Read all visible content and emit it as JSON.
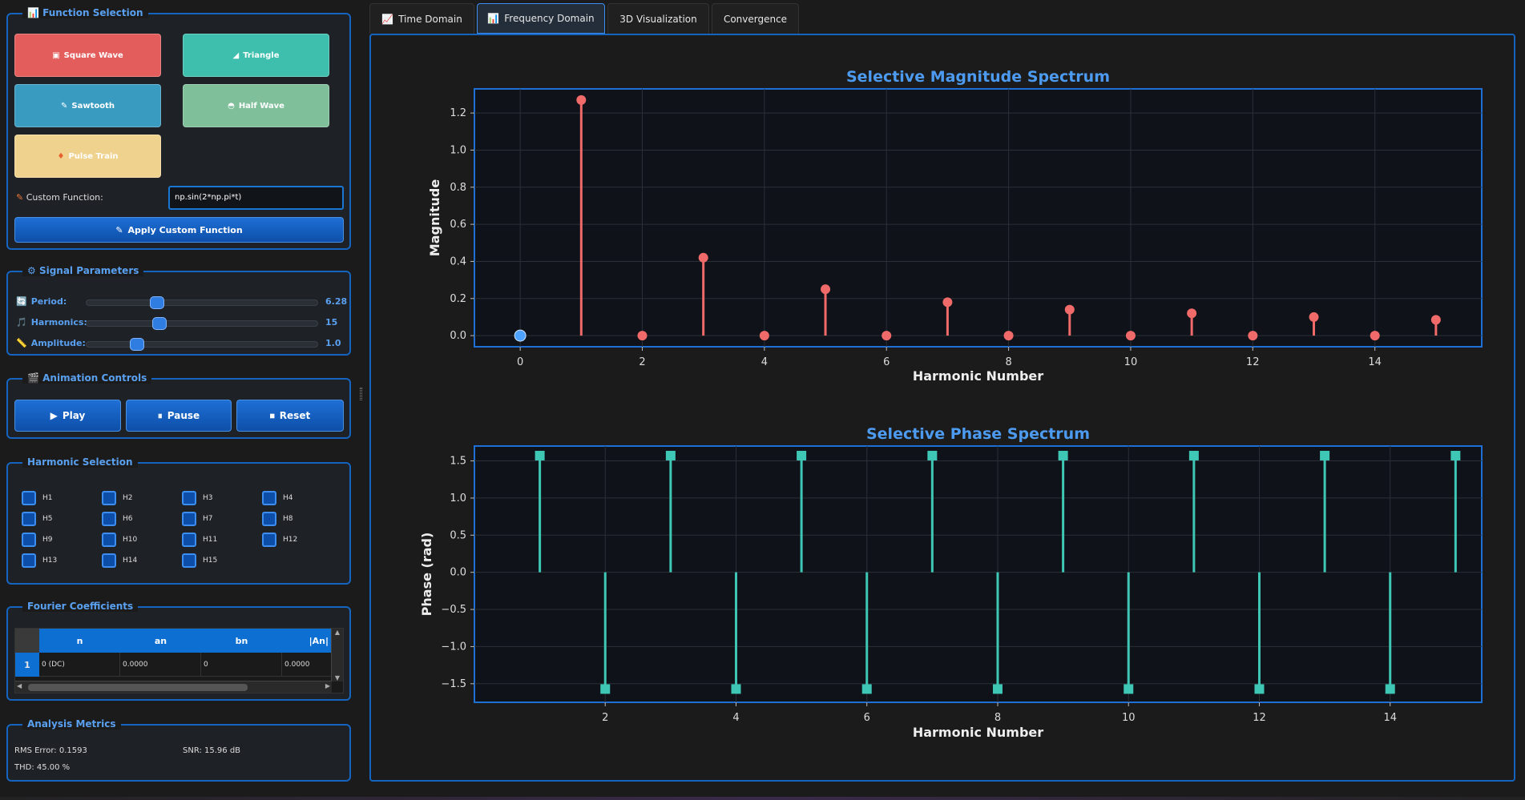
{
  "function_selection": {
    "title": "Function Selection",
    "buttons": [
      {
        "label": "Square Wave",
        "icon": "▣",
        "color": "#e35d5d"
      },
      {
        "label": "Triangle",
        "icon": "◢",
        "color": "#3ebfae"
      },
      {
        "label": "Sawtooth",
        "icon": "✎",
        "color": "#3a9bc0"
      },
      {
        "label": "Half Wave",
        "icon": "◓",
        "color": "#7fbf9a"
      },
      {
        "label": "Pulse Train",
        "icon": "♦",
        "color": "#f0d28f"
      }
    ],
    "custom_label": "Custom Function:",
    "custom_value": "np.sin(2*np.pi*t)",
    "apply_label": "Apply Custom Function"
  },
  "signal_parameters": {
    "title": "Signal Parameters",
    "params": [
      {
        "label": "Period:",
        "value": "6.28",
        "fraction": 0.29
      },
      {
        "label": "Harmonics:",
        "value": "15",
        "fraction": 0.3
      },
      {
        "label": "Amplitude:",
        "value": "1.0",
        "fraction": 0.2
      }
    ]
  },
  "animation_controls": {
    "title": "Animation Controls",
    "buttons": [
      "Play",
      "Pause",
      "Reset"
    ]
  },
  "harmonic_selection": {
    "title": "Harmonic Selection",
    "items": [
      "H1",
      "H2",
      "H3",
      "H4",
      "H5",
      "H6",
      "H7",
      "H8",
      "H9",
      "H10",
      "H11",
      "H12",
      "H13",
      "H14",
      "H15"
    ]
  },
  "fourier_coefficients": {
    "title": "Fourier Coefficients",
    "columns": [
      "n",
      "an",
      "bn",
      "|An|"
    ],
    "rows": [
      {
        "index": "1",
        "cells": [
          "0 (DC)",
          "0.0000",
          "0",
          "0.0000"
        ]
      }
    ]
  },
  "analysis_metrics": {
    "title": "Analysis Metrics",
    "rms": "RMS Error: 0.1593",
    "snr": "SNR: 15.96 dB",
    "thd": "THD: 45.00 %"
  },
  "tabs": [
    {
      "label": "Time Domain",
      "icon": "📈",
      "active": false
    },
    {
      "label": "Frequency Domain",
      "icon": "📊",
      "active": true
    },
    {
      "label": "3D Visualization",
      "icon": "",
      "active": false
    },
    {
      "label": "Convergence",
      "icon": "",
      "active": false
    }
  ],
  "chart_data": [
    {
      "type": "stem",
      "title": "Selective Magnitude Spectrum",
      "xlabel": "Harmonic Number",
      "ylabel": "Magnitude",
      "xlim": [
        -0.75,
        15.75
      ],
      "ylim": [
        -0.06,
        1.33
      ],
      "xticks": [
        0,
        2,
        4,
        6,
        8,
        10,
        12,
        14
      ],
      "yticks": [
        0.0,
        0.2,
        0.4,
        0.6,
        0.8,
        1.0,
        1.2
      ],
      "x": [
        0,
        1,
        2,
        3,
        4,
        5,
        6,
        7,
        8,
        9,
        10,
        11,
        12,
        13,
        14,
        15
      ],
      "values": [
        0,
        1.27,
        0,
        0.42,
        0,
        0.25,
        0,
        0.18,
        0,
        0.14,
        0,
        0.12,
        0,
        0.1,
        0,
        0.085
      ],
      "colors": {
        "stem": "#f06a6a",
        "dc": "#4da3ff"
      }
    },
    {
      "type": "stem",
      "title": "Selective Phase Spectrum",
      "xlabel": "Harmonic Number",
      "ylabel": "Phase (rad)",
      "xlim": [
        0.0,
        15.4
      ],
      "ylim": [
        -1.75,
        1.7
      ],
      "xticks": [
        2,
        4,
        6,
        8,
        10,
        12,
        14
      ],
      "yticks": [
        1.5,
        1.0,
        0.5,
        0.0,
        -0.5,
        -1.0,
        -1.5
      ],
      "x": [
        1,
        2,
        3,
        4,
        5,
        6,
        7,
        8,
        9,
        10,
        11,
        12,
        13,
        14,
        15
      ],
      "values": [
        1.571,
        -1.571,
        1.571,
        -1.571,
        1.571,
        -1.571,
        1.571,
        -1.571,
        1.571,
        -1.571,
        1.571,
        -1.571,
        1.571,
        -1.571,
        1.571
      ],
      "colors": {
        "stem": "#3fc7b6"
      }
    }
  ]
}
